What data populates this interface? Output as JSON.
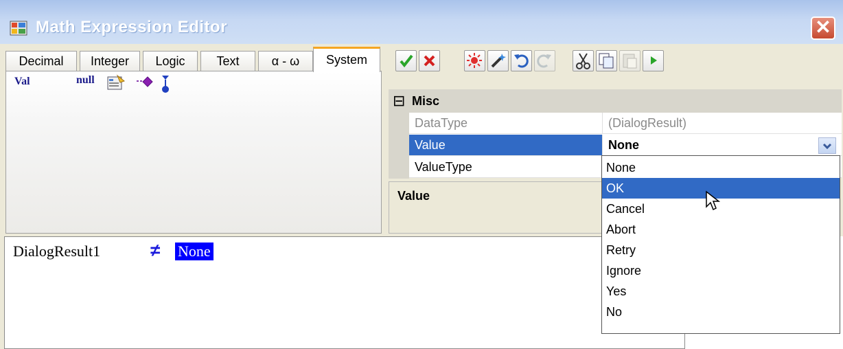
{
  "window": {
    "title": "Math Expression Editor",
    "close_symbol": "✕",
    "app_icon": "app-window-icon"
  },
  "tabs": [
    {
      "label": "Decimal"
    },
    {
      "label": "Integer"
    },
    {
      "label": "Logic"
    },
    {
      "label": "Text"
    },
    {
      "label": "α - ω"
    },
    {
      "label": "System",
      "active": true
    }
  ],
  "tab_panel": {
    "val_label": "Val",
    "null_label": "null",
    "icons": [
      "null-icon",
      "properties-icon",
      "arrow-diamond-icon",
      "pin-icon"
    ]
  },
  "toolbar": {
    "buttons": [
      "check-icon",
      "cross-icon",
      "highlight-icon",
      "wand-icon",
      "undo-icon",
      "redo-icon",
      "cut-icon",
      "copy-icon",
      "paste-icon",
      "run-icon"
    ]
  },
  "properties": {
    "collapse_symbol": "⊟",
    "category": "Misc",
    "rows": [
      {
        "name": "DataType",
        "value": "(DialogResult)"
      },
      {
        "name": "Value",
        "value": "None"
      },
      {
        "name": "ValueType",
        "value": ""
      }
    ]
  },
  "description": {
    "title": "Value"
  },
  "editor": {
    "variable": "DialogResult1",
    "operator": "≠",
    "value": "None"
  },
  "dropdown": {
    "options": [
      "None",
      "OK",
      "Cancel",
      "Abort",
      "Retry",
      "Ignore",
      "Yes",
      "No"
    ],
    "selected": "OK"
  },
  "colors": {
    "title_bar": "#b6cdf0",
    "selection": "#316ac5",
    "editor_highlight": "#0000ff",
    "close_button": "#d45a3f",
    "tab_accent": "#f5a623"
  }
}
